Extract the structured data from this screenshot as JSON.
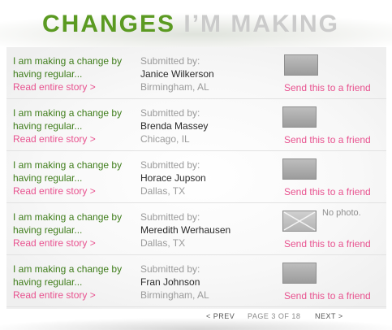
{
  "header": {
    "title_green": "CHANGES",
    "title_grey": "I’M MAKING"
  },
  "entries": [
    {
      "story": "I am making a change by having regular...",
      "read_more": "Read entire story >",
      "submitted_label": "Submitted by:",
      "name": "Janice Wilkerson",
      "location": "Birmingham, AL",
      "photo": "photo-thumbnail",
      "send": "Send this to a friend"
    },
    {
      "story": "I am making a change by having regular...",
      "read_more": "Read entire story >",
      "submitted_label": "Submitted by:",
      "name": "Brenda Massey",
      "location": "Chicago, IL",
      "photo": "photo-thumbnail",
      "send": "Send this to a friend"
    },
    {
      "story": "I am making a change by having regular...",
      "read_more": "Read entire story >",
      "submitted_label": "Submitted by:",
      "name": "Horace Jupson",
      "location": "Dallas, TX",
      "photo": "photo-thumbnail",
      "send": "Send this to a friend"
    },
    {
      "story": "I am making a change by having regular...",
      "read_more": "Read entire story >",
      "submitted_label": "Submitted by:",
      "name": "Meredith Werhausen",
      "location": "Dallas, TX",
      "photo": "no-photo-placeholder",
      "no_photo_text": "No photo.",
      "send": "Send this to a friend"
    },
    {
      "story": "I am making a change by having regular...",
      "read_more": "Read entire story >",
      "submitted_label": "Submitted by:",
      "name": "Fran Johnson",
      "location": "Birmingham, AL",
      "photo": "photo-thumbnail",
      "send": "Send this to a friend"
    }
  ],
  "pagination": {
    "prev": "< PREV",
    "page": "PAGE 3 OF 18",
    "next": "NEXT >"
  }
}
